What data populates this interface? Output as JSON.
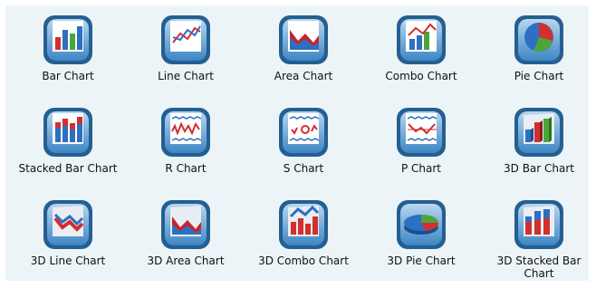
{
  "tiles": [
    {
      "label": "Bar Chart",
      "icon": "bar-chart-icon"
    },
    {
      "label": "Line Chart",
      "icon": "line-chart-icon"
    },
    {
      "label": "Area Chart",
      "icon": "area-chart-icon"
    },
    {
      "label": "Combo Chart",
      "icon": "combo-chart-icon"
    },
    {
      "label": "Pie Chart",
      "icon": "pie-chart-icon"
    },
    {
      "label": "Stacked Bar Chart",
      "icon": "stacked-bar-chart-icon"
    },
    {
      "label": "R Chart",
      "icon": "r-chart-icon"
    },
    {
      "label": "S Chart",
      "icon": "s-chart-icon"
    },
    {
      "label": "P Chart",
      "icon": "p-chart-icon"
    },
    {
      "label": "3D Bar Chart",
      "icon": "3d-bar-chart-icon"
    },
    {
      "label": "3D Line Chart",
      "icon": "3d-line-chart-icon"
    },
    {
      "label": "3D Area Chart",
      "icon": "3d-area-chart-icon"
    },
    {
      "label": "3D Combo Chart",
      "icon": "3d-combo-chart-icon"
    },
    {
      "label": "3D Pie Chart",
      "icon": "3d-pie-chart-icon"
    },
    {
      "label": "3D Stacked Bar Chart",
      "icon": "3d-stacked-bar-chart-icon"
    }
  ],
  "colors": {
    "panel_bg": "#ecf4f8",
    "tile_frame": "#2a6fa8",
    "tile_inner": "#7fb2da"
  }
}
